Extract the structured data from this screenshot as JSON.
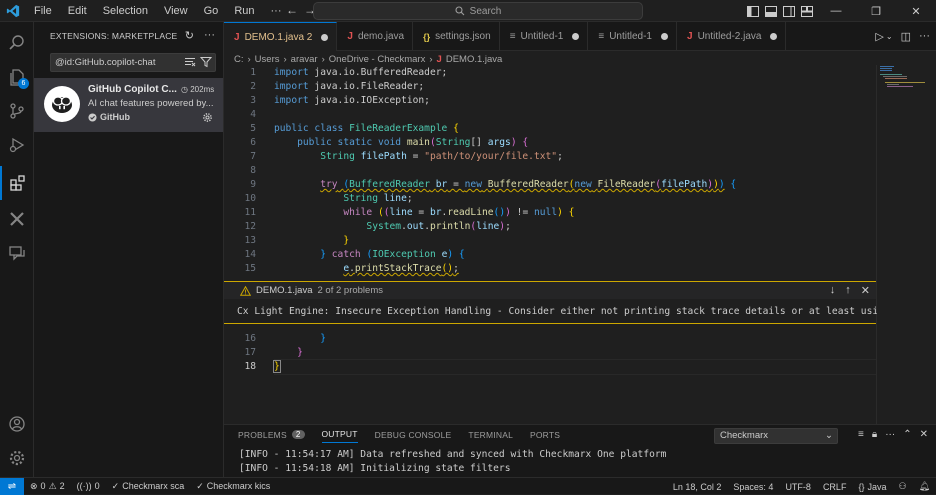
{
  "menu": [
    "File",
    "Edit",
    "Selection",
    "View",
    "Go",
    "Run"
  ],
  "more_menu": "···",
  "search_placeholder": "Search",
  "sidebar": {
    "title": "EXTENSIONS: MARKETPLACE",
    "search_value": "@id:GitHub.copilot-chat",
    "extension": {
      "name": "GitHub Copilot C...",
      "time": "202ms",
      "description": "AI chat features powered by...",
      "publisher": "GitHub"
    }
  },
  "activity_badge": "6",
  "tabs": [
    {
      "icon": "J",
      "label": "DEMO.1.java 2",
      "dirty": true,
      "active": true
    },
    {
      "icon": "J",
      "label": "demo.java",
      "dirty": false,
      "active": false
    },
    {
      "icon": "{}",
      "label": "settings.json",
      "dirty": false,
      "active": false
    },
    {
      "icon": "",
      "label": "Untitled-1",
      "dirty": true,
      "active": false
    },
    {
      "icon": "",
      "label": "Untitled-1",
      "dirty": true,
      "active": false
    },
    {
      "icon": "J",
      "label": "Untitled-2.java",
      "dirty": true,
      "active": false
    }
  ],
  "breadcrumb": [
    "C:",
    "Users",
    "aravar",
    "OneDrive - Checkmarx",
    "DEMO.1.java"
  ],
  "line_numbers": {
    "l1": "1",
    "l2": "2",
    "l3": "3",
    "l4": "4",
    "l5": "5",
    "l6": "6",
    "l7": "7",
    "l8": "8",
    "l9": "9",
    "l10": "10",
    "l11": "11",
    "l12": "12",
    "l13": "13",
    "l14": "14",
    "l15": "15",
    "l16": "16",
    "l17": "17",
    "l18": "18"
  },
  "peek": {
    "file": "DEMO.1.java",
    "count": "2 of 2 problems",
    "message": "Cx Light Engine: Insecure Exception Handling - Consider either not printing stack trace details or at least using"
  },
  "panel": {
    "tabs": [
      "PROBLEMS",
      "OUTPUT",
      "DEBUG CONSOLE",
      "TERMINAL",
      "PORTS"
    ],
    "problems_count": "2",
    "channel": "Checkmarx",
    "output": [
      "[INFO - 11:54:17 AM] Data refreshed and synced with Checkmarx One platform",
      "[INFO - 11:54:18 AM] Initializing state filters"
    ]
  },
  "status": {
    "errors": "0",
    "warnings": "2",
    "ports": "0",
    "sca": "Checkmarx sca",
    "kics": "Checkmarx kics",
    "position": "Ln 18, Col 2",
    "spaces": "Spaces: 4",
    "encoding": "UTF-8",
    "eol": "CRLF",
    "language": "Java"
  },
  "colors": {
    "accent": "#0078d4",
    "warning": "#cca700",
    "java_icon": "#e05252"
  }
}
